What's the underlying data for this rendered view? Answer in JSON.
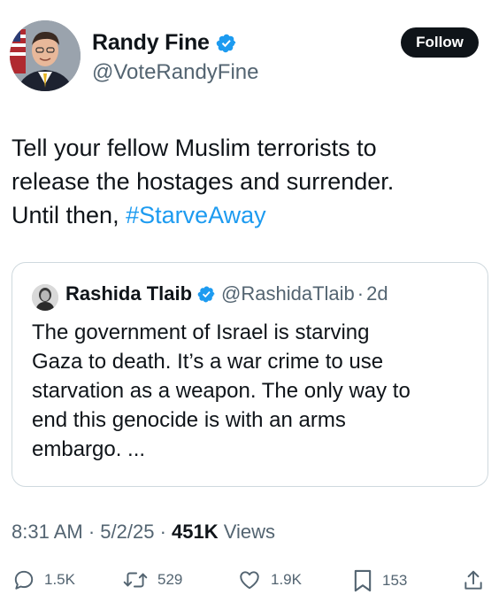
{
  "author": {
    "name": "Randy Fine",
    "handle": "@VoteRandyFine",
    "verified": true,
    "follow_label": "Follow"
  },
  "tweet": {
    "text_lines": [
      "Tell your fellow Muslim terrorists to",
      "release the hostages and surrender.",
      "Until then, "
    ],
    "hashtag": "#StarveAway"
  },
  "quoted": {
    "name": "Rashida Tlaib",
    "handle": "@RashidaTlaib",
    "separator": "·",
    "time": "2d",
    "verified": true,
    "text_lines": [
      "The government of Israel is starving",
      "Gaza to death. It’s a war crime to use",
      "starvation as a weapon. The only way to",
      "end this genocide is with an arms",
      "embargo. ..."
    ]
  },
  "meta": {
    "time": "8:31 AM",
    "separator": "·",
    "date": "5/2/25",
    "views_count": "451K",
    "views_label": "Views"
  },
  "actions": {
    "replies": "1.5K",
    "reposts": "529",
    "likes": "1.9K",
    "bookmarks": "153"
  },
  "colors": {
    "accent": "#1d9bf0",
    "text": "#0f1419",
    "secondary": "#536471",
    "border": "#cfd9de"
  },
  "icons": [
    "verified-badge-icon",
    "reply-icon",
    "repost-icon",
    "like-icon",
    "bookmark-icon",
    "share-icon"
  ]
}
